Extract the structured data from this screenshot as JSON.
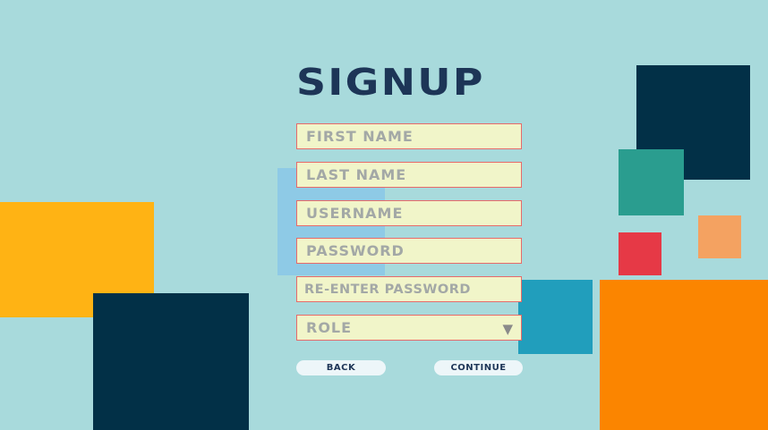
{
  "title": "SIGNUP",
  "fields": {
    "first_name": {
      "placeholder": "FIRST NAME",
      "value": ""
    },
    "last_name": {
      "placeholder": "LAST NAME",
      "value": ""
    },
    "username": {
      "placeholder": "USERNAME",
      "value": ""
    },
    "password": {
      "placeholder": "PASSWORD",
      "value": ""
    },
    "reenter_password": {
      "placeholder": "RE-ENTER PASSWORD",
      "value": ""
    }
  },
  "role": {
    "selected": "ROLE",
    "arrow": "▼"
  },
  "buttons": {
    "back": "BACK",
    "continue": "CONTINUE"
  },
  "colors": {
    "background": "#a8dadc",
    "title": "#1d3557",
    "field_bg": "#f1f5c9",
    "field_border": "#e76a6a",
    "yellow": "#ffb314",
    "navy": "#023047",
    "light_blue": "#8ecae6",
    "cyan": "#219ebc",
    "teal": "#2a9d8f",
    "peach": "#f4a261",
    "red": "#e63946",
    "orange": "#fb8500"
  }
}
